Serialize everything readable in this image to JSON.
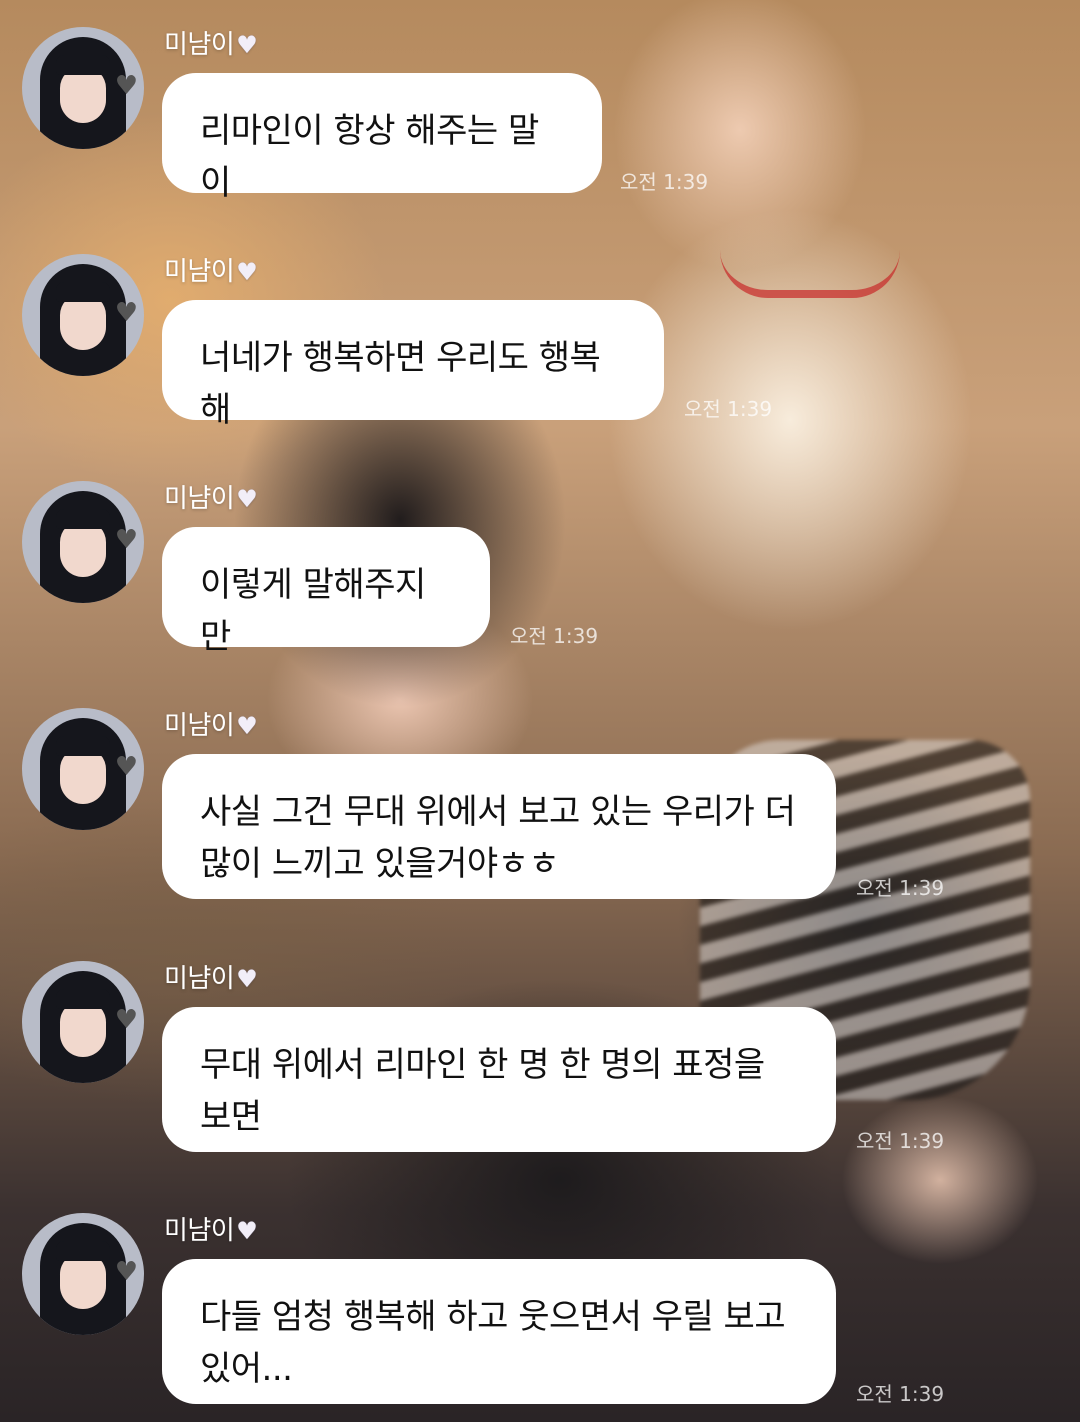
{
  "sender": {
    "name": "미냠이",
    "heart_icon": "white-heart-icon"
  },
  "messages": [
    {
      "text": "리마인이 항상 해주는 말이",
      "time": "오전 1:39"
    },
    {
      "text": "너네가 행복하면 우리도 행복해",
      "time": "오전 1:39"
    },
    {
      "text": "이렇게 말해주지만",
      "time": "오전 1:39"
    },
    {
      "text": "사실 그건 무대 위에서 보고 있는 우리가 더 많이 느끼고 있을거야ㅎㅎ",
      "time": "오전 1:39"
    },
    {
      "text": "무대 위에서 리마인 한 명 한 명의 표정을 보면",
      "time": "오전 1:39"
    },
    {
      "text": "다들 엄청 행복해 하고 웃으면서 우릴 보고 있어...",
      "time": "오전 1:39"
    }
  ],
  "colors": {
    "bubble": "#ffffff",
    "text": "#111111",
    "name": "#ffffff"
  }
}
